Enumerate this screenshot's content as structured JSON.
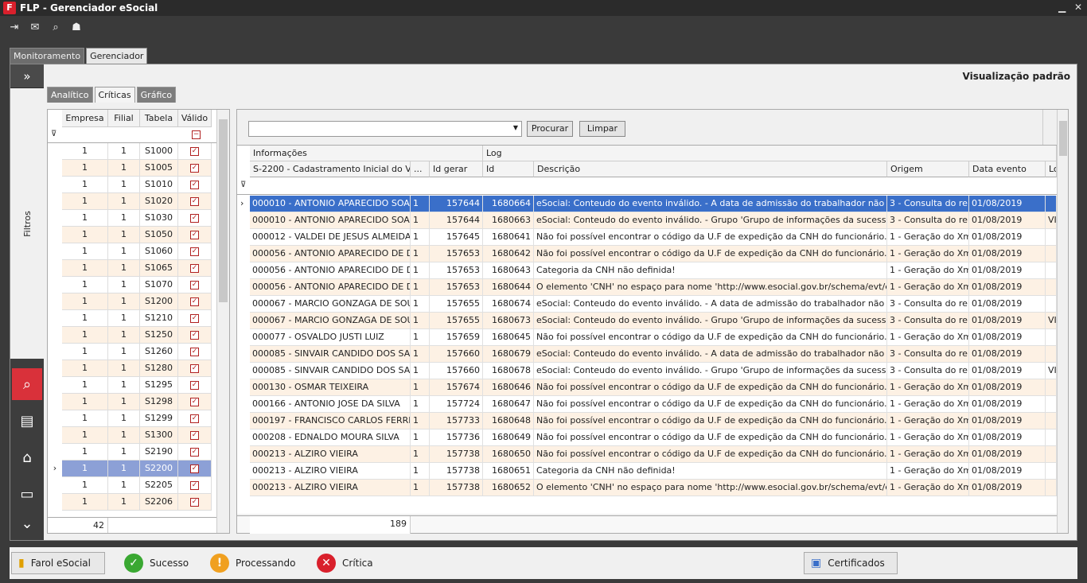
{
  "window": {
    "title": "FLP - Gerenciador eSocial",
    "logo": "F"
  },
  "toolbar": {
    "icons": [
      "exit-icon",
      "message-icon",
      "search-icon",
      "user-icon"
    ]
  },
  "main_tabs": [
    {
      "label": "Monitoramento"
    },
    {
      "label": "Gerenciador"
    }
  ],
  "view_label": "Visualização padrão",
  "sub_tabs": [
    {
      "label": "Analítico"
    },
    {
      "label": "Críticas"
    },
    {
      "label": "Gráfico"
    }
  ],
  "left_nav": {
    "expand": "»",
    "filtros": "Filtros",
    "more": "⌄"
  },
  "left_grid": {
    "headers": [
      "Empresa",
      "Filial",
      "Tabela",
      "Válido"
    ],
    "rows": [
      {
        "empresa": "1",
        "filial": "1",
        "tabela": "S1000"
      },
      {
        "empresa": "1",
        "filial": "1",
        "tabela": "S1005"
      },
      {
        "empresa": "1",
        "filial": "1",
        "tabela": "S1010"
      },
      {
        "empresa": "1",
        "filial": "1",
        "tabela": "S1020"
      },
      {
        "empresa": "1",
        "filial": "1",
        "tabela": "S1030"
      },
      {
        "empresa": "1",
        "filial": "1",
        "tabela": "S1050"
      },
      {
        "empresa": "1",
        "filial": "1",
        "tabela": "S1060"
      },
      {
        "empresa": "1",
        "filial": "1",
        "tabela": "S1065"
      },
      {
        "empresa": "1",
        "filial": "1",
        "tabela": "S1070"
      },
      {
        "empresa": "1",
        "filial": "1",
        "tabela": "S1200"
      },
      {
        "empresa": "1",
        "filial": "1",
        "tabela": "S1210"
      },
      {
        "empresa": "1",
        "filial": "1",
        "tabela": "S1250"
      },
      {
        "empresa": "1",
        "filial": "1",
        "tabela": "S1260"
      },
      {
        "empresa": "1",
        "filial": "1",
        "tabela": "S1280"
      },
      {
        "empresa": "1",
        "filial": "1",
        "tabela": "S1295"
      },
      {
        "empresa": "1",
        "filial": "1",
        "tabela": "S1298"
      },
      {
        "empresa": "1",
        "filial": "1",
        "tabela": "S1299"
      },
      {
        "empresa": "1",
        "filial": "1",
        "tabela": "S1300"
      },
      {
        "empresa": "1",
        "filial": "1",
        "tabela": "S2190"
      },
      {
        "empresa": "1",
        "filial": "1",
        "tabela": "S2200"
      },
      {
        "empresa": "1",
        "filial": "1",
        "tabela": "S2205"
      },
      {
        "empresa": "1",
        "filial": "1",
        "tabela": "S2206"
      }
    ],
    "count": "42"
  },
  "right_panel": {
    "procurar": "Procurar",
    "limpar": "Limpar",
    "groups": [
      "Informações",
      "Log"
    ],
    "headers": [
      "S-2200 - Cadastramento Inicial do Vín...",
      "...",
      "Id gerar",
      "Id",
      "Descrição",
      "Origem",
      "Data evento",
      "Lo"
    ],
    "rows": [
      {
        "nome": "000010 - ANTONIO APARECIDO SOA...",
        "n": "1",
        "idg": "157644",
        "id": "1680664",
        "desc": "eSocial: Conteudo do evento inválido. - A data de admissão do trabalhador não poderá ...",
        "origem": "3 - Consulta do re...",
        "data": "01/08/2019",
        "lo": ""
      },
      {
        "nome": "000010 - ANTONIO APARECIDO SOA...",
        "n": "1",
        "idg": "157644",
        "id": "1680663",
        "desc": "eSocial: Conteudo do evento inválido. - Grupo 'Grupo de informações da sucessão de vín...",
        "origem": "3 - Consulta do re...",
        "data": "01/08/2019",
        "lo": "VI"
      },
      {
        "nome": "000012 - VALDEI DE JESUS ALMEIDA",
        "n": "1",
        "idg": "157645",
        "id": "1680641",
        "desc": "Não foi possível encontrar o código da U.F de expedição da CNH do funcionário. Por fav...",
        "origem": "1 - Geração do Xml",
        "data": "01/08/2019",
        "lo": ""
      },
      {
        "nome": "000056 - ANTONIO APARECIDO DE D...",
        "n": "1",
        "idg": "157653",
        "id": "1680642",
        "desc": "Não foi possível encontrar o código da U.F de expedição da CNH do funcionário. Por fav...",
        "origem": "1 - Geração do Xml",
        "data": "01/08/2019",
        "lo": ""
      },
      {
        "nome": "000056 - ANTONIO APARECIDO DE D...",
        "n": "1",
        "idg": "157653",
        "id": "1680643",
        "desc": "Categoria da CNH não definida!",
        "origem": "1 - Geração do Xml",
        "data": "01/08/2019",
        "lo": ""
      },
      {
        "nome": "000056 - ANTONIO APARECIDO DE D...",
        "n": "1",
        "idg": "157653",
        "id": "1680644",
        "desc": "O elemento 'CNH' no espaço para nome 'http://www.esocial.gov.br/schema/evt/evtAdmi...",
        "origem": "1 - Geração do Xml",
        "data": "01/08/2019",
        "lo": ""
      },
      {
        "nome": "000067 - MARCIO GONZAGA DE SOUZA",
        "n": "1",
        "idg": "157655",
        "id": "1680674",
        "desc": "eSocial: Conteudo do evento inválido. - A data de admissão do trabalhador não poderá ...",
        "origem": "3 - Consulta do re...",
        "data": "01/08/2019",
        "lo": ""
      },
      {
        "nome": "000067 - MARCIO GONZAGA DE SOUZA",
        "n": "1",
        "idg": "157655",
        "id": "1680673",
        "desc": "eSocial: Conteudo do evento inválido. - Grupo 'Grupo de informações da sucessão de vín...",
        "origem": "3 - Consulta do re...",
        "data": "01/08/2019",
        "lo": "VI"
      },
      {
        "nome": "000077 - OSVALDO JUSTI LUIZ",
        "n": "1",
        "idg": "157659",
        "id": "1680645",
        "desc": "Não foi possível encontrar o código da U.F de expedição da CNH do funcionário. Por fav...",
        "origem": "1 - Geração do Xml",
        "data": "01/08/2019",
        "lo": ""
      },
      {
        "nome": "000085 - SINVAIR CANDIDO DOS SAN...",
        "n": "1",
        "idg": "157660",
        "id": "1680679",
        "desc": "eSocial: Conteudo do evento inválido. - A data de admissão do trabalhador não poderá ...",
        "origem": "3 - Consulta do re...",
        "data": "01/08/2019",
        "lo": ""
      },
      {
        "nome": "000085 - SINVAIR CANDIDO DOS SAN...",
        "n": "1",
        "idg": "157660",
        "id": "1680678",
        "desc": "eSocial: Conteudo do evento inválido. - Grupo 'Grupo de informações da sucessão de vín...",
        "origem": "3 - Consulta do re...",
        "data": "01/08/2019",
        "lo": "VI"
      },
      {
        "nome": "000130 - OSMAR TEIXEIRA",
        "n": "1",
        "idg": "157674",
        "id": "1680646",
        "desc": "Não foi possível encontrar o código da U.F de expedição da CNH do funcionário. Por fav...",
        "origem": "1 - Geração do Xml",
        "data": "01/08/2019",
        "lo": ""
      },
      {
        "nome": "000166 - ANTONIO JOSE DA SILVA",
        "n": "1",
        "idg": "157724",
        "id": "1680647",
        "desc": "Não foi possível encontrar o código da U.F de expedição da CNH do funcionário. Por fav...",
        "origem": "1 - Geração do Xml",
        "data": "01/08/2019",
        "lo": ""
      },
      {
        "nome": "000197 - FRANCISCO CARLOS FERRE...",
        "n": "1",
        "idg": "157733",
        "id": "1680648",
        "desc": "Não foi possível encontrar o código da U.F de expedição da CNH do funcionário. Por fav...",
        "origem": "1 - Geração do Xml",
        "data": "01/08/2019",
        "lo": ""
      },
      {
        "nome": "000208 - EDNALDO MOURA SILVA",
        "n": "1",
        "idg": "157736",
        "id": "1680649",
        "desc": "Não foi possível encontrar o código da U.F de expedição da CNH do funcionário. Por fav...",
        "origem": "1 - Geração do Xml",
        "data": "01/08/2019",
        "lo": ""
      },
      {
        "nome": "000213 - ALZIRO VIEIRA",
        "n": "1",
        "idg": "157738",
        "id": "1680650",
        "desc": "Não foi possível encontrar o código da U.F de expedição da CNH do funcionário. Por fav...",
        "origem": "1 - Geração do Xml",
        "data": "01/08/2019",
        "lo": ""
      },
      {
        "nome": "000213 - ALZIRO VIEIRA",
        "n": "1",
        "idg": "157738",
        "id": "1680651",
        "desc": "Categoria da CNH não definida!",
        "origem": "1 - Geração do Xml",
        "data": "01/08/2019",
        "lo": ""
      },
      {
        "nome": "000213 - ALZIRO VIEIRA",
        "n": "1",
        "idg": "157738",
        "id": "1680652",
        "desc": "O elemento 'CNH' no espaço para nome 'http://www.esocial.gov.br/schema/evt/evtAdmi...",
        "origem": "1 - Geração do Xml",
        "data": "01/08/2019",
        "lo": ""
      }
    ],
    "count": "189"
  },
  "footer": {
    "farol": "Farol eSocial",
    "sucesso": "Sucesso",
    "processando": "Processando",
    "critica": "Crítica",
    "certificados": "Certificados"
  },
  "colors": {
    "accent": "#d9202c",
    "selected": "#3a6fc9",
    "alt_row": "#fdf1e4",
    "success": "#3aa832",
    "warning": "#f0a020"
  }
}
